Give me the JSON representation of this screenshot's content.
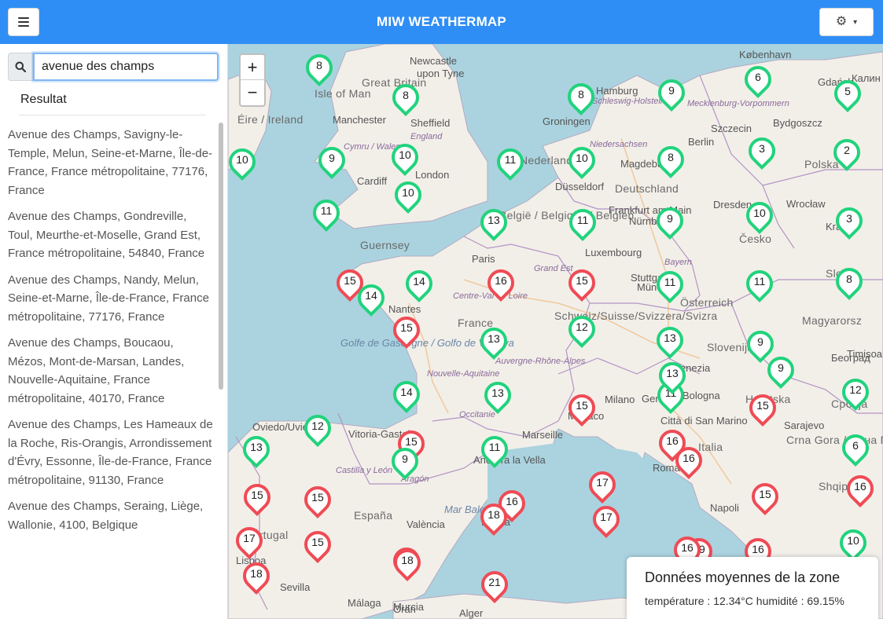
{
  "navbar": {
    "title": "MIW WEATHERMAP",
    "menu_icon": "hamburger-icon",
    "settings_icon": "gear-icon",
    "settings_chevron": "chevron-down-icon",
    "background": "#2f8ef5"
  },
  "sidebar": {
    "search": {
      "icon": "search-icon",
      "value": "avenue des champs"
    },
    "results_header": "Resultat",
    "results": [
      "Avenue des Champs, Savigny-le-Temple, Melun, Seine-et-Marne, Île-de-France, France métropolitaine, 77176, France",
      "Avenue des Champs, Gondreville, Toul, Meurthe-et-Moselle, Grand Est, France métropolitaine, 54840, France",
      "Avenue des Champs, Nandy, Melun, Seine-et-Marne, Île-de-France, France métropolitaine, 77176, France",
      "Avenue des Champs, Boucaou, Mézos, Mont-de-Marsan, Landes, Nouvelle-Aquitaine, France métropolitaine, 40170, France",
      "Avenue des Champs, Les Hameaux de la Roche, Ris-Orangis, Arrondissement d'Évry, Essonne, Île-de-France, France métropolitaine, 91130, France",
      "Avenue des Champs, Seraing, Liège, Wallonie, 4100, Belgique"
    ]
  },
  "map": {
    "zoom_in": "+",
    "zoom_out": "−",
    "colors": {
      "warm": "#ef4b55",
      "cool": "#21d37c",
      "sea": "#aad3df",
      "land": "#f2efe9"
    },
    "labels": [
      {
        "text": "Newcastle",
        "kind": "city"
      },
      {
        "text": "upon Tyne",
        "kind": "city"
      },
      {
        "text": "Great Britain",
        "kind": "country"
      },
      {
        "text": "Isle of Man",
        "kind": "country"
      },
      {
        "text": "Éire / Ireland",
        "kind": "country"
      },
      {
        "text": "Manchester",
        "kind": "city"
      },
      {
        "text": "Sheffield",
        "kind": "city"
      },
      {
        "text": "England",
        "kind": "region"
      },
      {
        "text": "Cymru / Wales",
        "kind": "region"
      },
      {
        "text": "Cardiff",
        "kind": "city"
      },
      {
        "text": "London",
        "kind": "city"
      },
      {
        "text": "Guernsey",
        "kind": "country"
      },
      {
        "text": "Groningen",
        "kind": "city"
      },
      {
        "text": "Nederland",
        "kind": "country"
      },
      {
        "text": "Düsseldorf",
        "kind": "city"
      },
      {
        "text": "België / Belgique / Belgien",
        "kind": "country"
      },
      {
        "text": "Luxembourg",
        "kind": "city"
      },
      {
        "text": "Paris",
        "kind": "city"
      },
      {
        "text": "France",
        "kind": "country"
      },
      {
        "text": "Nantes",
        "kind": "city"
      },
      {
        "text": "Golfe de Gascogne / Golfo de Vizcaya",
        "kind": "sea"
      },
      {
        "text": "Centre-Val de Loire",
        "kind": "region"
      },
      {
        "text": "Nouvelle-Aquitaine",
        "kind": "region"
      },
      {
        "text": "Auvergne-Rhône-Alpes",
        "kind": "region"
      },
      {
        "text": "Occitanie",
        "kind": "region"
      },
      {
        "text": "Marseille",
        "kind": "city"
      },
      {
        "text": "Monaco",
        "kind": "city"
      },
      {
        "text": "Hamburg",
        "kind": "city"
      },
      {
        "text": "Schleswig-Holstein",
        "kind": "region"
      },
      {
        "text": "Niedersachsen",
        "kind": "region"
      },
      {
        "text": "Magdeburg",
        "kind": "city"
      },
      {
        "text": "Deutschland",
        "kind": "country"
      },
      {
        "text": "Frankfurt am Main",
        "kind": "city"
      },
      {
        "text": "Nürnberg",
        "kind": "city"
      },
      {
        "text": "Stuttgart",
        "kind": "city"
      },
      {
        "text": "Bayern",
        "kind": "region"
      },
      {
        "text": "München",
        "kind": "city"
      },
      {
        "text": "Grand Est",
        "kind": "region"
      },
      {
        "text": "Schweiz/Suisse/Svizzera/Svizra",
        "kind": "country"
      },
      {
        "text": "Österreich",
        "kind": "country"
      },
      {
        "text": "Berlin",
        "kind": "city"
      },
      {
        "text": "Dresden",
        "kind": "city"
      },
      {
        "text": "Mecklenburg-Vorpommern",
        "kind": "region"
      },
      {
        "text": "Szczecin",
        "kind": "city"
      },
      {
        "text": "Bydgoszcz",
        "kind": "city"
      },
      {
        "text": "Gdańsk",
        "kind": "city"
      },
      {
        "text": "Калин",
        "kind": "city"
      },
      {
        "text": "Polska",
        "kind": "country"
      },
      {
        "text": "Wrocław",
        "kind": "city"
      },
      {
        "text": "Česko",
        "kind": "country"
      },
      {
        "text": "Krak",
        "kind": "city"
      },
      {
        "text": "Slover",
        "kind": "country"
      },
      {
        "text": "Magyarorsz",
        "kind": "country"
      },
      {
        "text": "Slovenija",
        "kind": "country"
      },
      {
        "text": "Timișoara",
        "kind": "city"
      },
      {
        "text": "Hrvatska",
        "kind": "country"
      },
      {
        "text": "Sarajevo",
        "kind": "city"
      },
      {
        "text": "Београд",
        "kind": "city"
      },
      {
        "text": "Србија",
        "kind": "country"
      },
      {
        "text": "Crna Gora / Црна Гора",
        "kind": "country"
      },
      {
        "text": "Shqipë",
        "kind": "country"
      },
      {
        "text": "Milano",
        "kind": "city"
      },
      {
        "text": "Venezia",
        "kind": "city"
      },
      {
        "text": "Genova",
        "kind": "city"
      },
      {
        "text": "Bologna",
        "kind": "city"
      },
      {
        "text": "Città di San Marino",
        "kind": "city"
      },
      {
        "text": "Italia",
        "kind": "country"
      },
      {
        "text": "Roma",
        "kind": "city"
      },
      {
        "text": "Napoli",
        "kind": "city"
      },
      {
        "text": "Oviedo/Uviéu",
        "kind": "city"
      },
      {
        "text": "Vitoria-Gasteiz",
        "kind": "city"
      },
      {
        "text": "Andorra la Vella",
        "kind": "city"
      },
      {
        "text": "Castilla y León",
        "kind": "region"
      },
      {
        "text": "Aragón",
        "kind": "region"
      },
      {
        "text": "España",
        "kind": "country"
      },
      {
        "text": "València",
        "kind": "city"
      },
      {
        "text": "Mar Balear",
        "kind": "sea"
      },
      {
        "text": "Palma",
        "kind": "city"
      },
      {
        "text": "Portugal",
        "kind": "country"
      },
      {
        "text": "Lisboa",
        "kind": "city"
      },
      {
        "text": "Sevilla",
        "kind": "city"
      },
      {
        "text": "Málaga",
        "kind": "city"
      },
      {
        "text": "Murcia",
        "kind": "city"
      },
      {
        "text": "Oran",
        "kind": "city"
      },
      {
        "text": "Alger",
        "kind": "city"
      },
      {
        "text": "København",
        "kind": "city"
      }
    ],
    "markers": [
      {
        "v": "8",
        "t": "cool"
      },
      {
        "v": "8",
        "t": "cool"
      },
      {
        "v": "8",
        "t": "cool"
      },
      {
        "v": "9",
        "t": "cool"
      },
      {
        "v": "6",
        "t": "cool"
      },
      {
        "v": "5",
        "t": "cool"
      },
      {
        "v": "10",
        "t": "cool"
      },
      {
        "v": "9",
        "t": "cool"
      },
      {
        "v": "10",
        "t": "cool"
      },
      {
        "v": "11",
        "t": "cool"
      },
      {
        "v": "10",
        "t": "cool"
      },
      {
        "v": "8",
        "t": "cool"
      },
      {
        "v": "3",
        "t": "cool"
      },
      {
        "v": "2",
        "t": "cool"
      },
      {
        "v": "10",
        "t": "cool"
      },
      {
        "v": "11",
        "t": "cool"
      },
      {
        "v": "13",
        "t": "cool"
      },
      {
        "v": "11",
        "t": "cool"
      },
      {
        "v": "9",
        "t": "cool"
      },
      {
        "v": "10",
        "t": "cool"
      },
      {
        "v": "3",
        "t": "cool"
      },
      {
        "v": "15",
        "t": "warm"
      },
      {
        "v": "14",
        "t": "cool"
      },
      {
        "v": "14",
        "t": "cool"
      },
      {
        "v": "16",
        "t": "warm"
      },
      {
        "v": "15",
        "t": "warm"
      },
      {
        "v": "11",
        "t": "cool"
      },
      {
        "v": "11",
        "t": "cool"
      },
      {
        "v": "8",
        "t": "cool"
      },
      {
        "v": "15",
        "t": "warm"
      },
      {
        "v": "12",
        "t": "cool"
      },
      {
        "v": "13",
        "t": "cool"
      },
      {
        "v": "13",
        "t": "cool"
      },
      {
        "v": "11",
        "t": "cool"
      },
      {
        "v": "9",
        "t": "cool"
      },
      {
        "v": "9",
        "t": "cool"
      },
      {
        "v": "14",
        "t": "cool"
      },
      {
        "v": "13",
        "t": "cool"
      },
      {
        "v": "15",
        "t": "warm"
      },
      {
        "v": "13",
        "t": "cool"
      },
      {
        "v": "15",
        "t": "warm"
      },
      {
        "v": "12",
        "t": "cool"
      },
      {
        "v": "13",
        "t": "cool"
      },
      {
        "v": "12",
        "t": "cool"
      },
      {
        "v": "15",
        "t": "warm"
      },
      {
        "v": "9",
        "t": "cool"
      },
      {
        "v": "11",
        "t": "cool"
      },
      {
        "v": "16",
        "t": "warm"
      },
      {
        "v": "16",
        "t": "warm"
      },
      {
        "v": "6",
        "t": "cool"
      },
      {
        "v": "16",
        "t": "warm"
      },
      {
        "v": "15",
        "t": "warm"
      },
      {
        "v": "17",
        "t": "warm"
      },
      {
        "v": "16",
        "t": "warm"
      },
      {
        "v": "18",
        "t": "warm"
      },
      {
        "v": "17",
        "t": "warm"
      },
      {
        "v": "15",
        "t": "warm"
      },
      {
        "v": "15",
        "t": "warm"
      },
      {
        "v": "15",
        "t": "warm"
      },
      {
        "v": "17",
        "t": "warm"
      },
      {
        "v": "18",
        "t": "warm"
      },
      {
        "v": "18",
        "t": "warm"
      },
      {
        "v": "18",
        "t": "warm"
      },
      {
        "v": "21",
        "t": "warm"
      },
      {
        "v": "19",
        "t": "warm"
      },
      {
        "v": "16",
        "t": "warm"
      },
      {
        "v": "16",
        "t": "warm"
      },
      {
        "v": "10",
        "t": "cool"
      }
    ]
  },
  "info_panel": {
    "title": "Données moyennes de la zone",
    "line": "température : 12.34°C humidité : 69.15%"
  }
}
